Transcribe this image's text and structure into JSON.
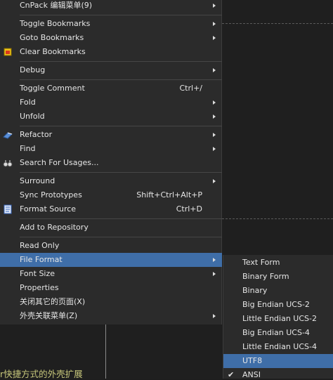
{
  "context_menu": {
    "items": [
      {
        "label": "CnPack 编辑菜单(9)",
        "shortcut": "",
        "submenu": true
      },
      {
        "label": "Toggle Bookmarks",
        "shortcut": "",
        "submenu": true
      },
      {
        "label": "Goto Bookmarks",
        "shortcut": "",
        "submenu": true
      },
      {
        "label": "Clear Bookmarks",
        "shortcut": "",
        "submenu": false,
        "icon": "clear-bookmarks-icon"
      },
      {
        "label": "Debug",
        "shortcut": "",
        "submenu": true
      },
      {
        "label": "Toggle Comment",
        "shortcut": "Ctrl+/",
        "submenu": false
      },
      {
        "label": "Fold",
        "shortcut": "",
        "submenu": true
      },
      {
        "label": "Unfold",
        "shortcut": "",
        "submenu": true
      },
      {
        "label": "Refactor",
        "shortcut": "",
        "submenu": true,
        "icon": "refactor-icon"
      },
      {
        "label": "Find",
        "shortcut": "",
        "submenu": true
      },
      {
        "label": "Search For Usages...",
        "shortcut": "",
        "submenu": false,
        "icon": "binoculars-icon"
      },
      {
        "label": "Surround",
        "shortcut": "",
        "submenu": true
      },
      {
        "label": "Sync Prototypes",
        "shortcut": "Shift+Ctrl+Alt+P",
        "submenu": false
      },
      {
        "label": "Format Source",
        "shortcut": "Ctrl+D",
        "submenu": false,
        "icon": "format-source-icon"
      },
      {
        "label": "Add to Repository",
        "shortcut": "",
        "submenu": false
      },
      {
        "label": "Read Only",
        "shortcut": "",
        "submenu": false
      },
      {
        "label": "File Format",
        "shortcut": "",
        "submenu": true,
        "highlighted": true
      },
      {
        "label": "Font Size",
        "shortcut": "",
        "submenu": true
      },
      {
        "label": "Properties",
        "shortcut": "",
        "submenu": false
      },
      {
        "label": "关闭其它的页面(X)",
        "shortcut": "",
        "submenu": false
      },
      {
        "label": "外壳关联菜单(Z)",
        "shortcut": "",
        "submenu": true
      }
    ]
  },
  "file_format_submenu": {
    "items": [
      {
        "label": "Text Form"
      },
      {
        "label": "Binary Form"
      },
      {
        "label": "Binary"
      },
      {
        "label": "Big Endian UCS-2"
      },
      {
        "label": "Little Endian UCS-2"
      },
      {
        "label": "Big Endian UCS-4"
      },
      {
        "label": "Little Endian UCS-4"
      },
      {
        "label": "UTF8",
        "highlighted": true
      },
      {
        "label": "ANSI",
        "checked": true
      }
    ]
  },
  "editor": {
    "partial_text": "r快捷方式的外壳扩展"
  },
  "colors": {
    "menu_bg": "#2b2b2b",
    "highlight": "#3f6ea8",
    "text": "#e6e6e6",
    "editor_text": "#c6c67a"
  }
}
